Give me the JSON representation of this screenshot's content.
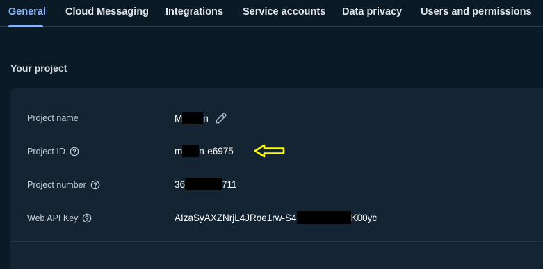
{
  "tabs": [
    {
      "label": "General",
      "active": true
    },
    {
      "label": "Cloud Messaging"
    },
    {
      "label": "Integrations"
    },
    {
      "label": "Service accounts"
    },
    {
      "label": "Data privacy"
    },
    {
      "label": "Users and permissions"
    }
  ],
  "section_title": "Your project",
  "project": {
    "name_label": "Project name",
    "name_prefix": "M",
    "name_suffix": "n",
    "id_label": "Project ID",
    "id_prefix": "m",
    "id_suffix": "n-e6975",
    "number_label": "Project number",
    "number_prefix": "36",
    "number_suffix": "711",
    "api_key_label": "Web API Key",
    "api_key_prefix": "AIzaSyAXZNrjL4JRoe1rw-S4",
    "api_key_suffix": "K00yc"
  },
  "colors": {
    "background": "#0b1a27",
    "card": "#142433",
    "accent": "#8ab4f8",
    "annotation_arrow": "#ffff00"
  },
  "icons": {
    "edit": "pencil-icon",
    "help": "help-circle-icon",
    "annotation": "arrow-left-icon"
  }
}
